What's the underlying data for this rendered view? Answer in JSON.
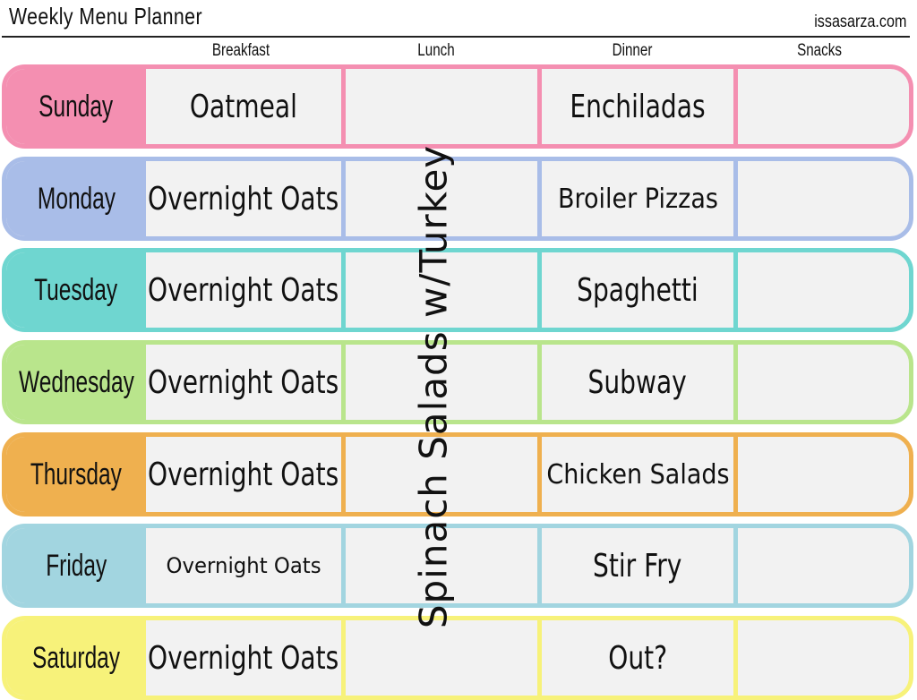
{
  "header": {
    "title": "Weekly Menu Planner",
    "website": "issasarza.com"
  },
  "columns": [
    "Breakfast",
    "Lunch",
    "Dinner",
    "Snacks"
  ],
  "lunch_all_week": "Spinach Salads w/Turkey",
  "days": [
    {
      "day": "Sunday",
      "color": "#f48fb1",
      "breakfast": "Oatmeal",
      "lunch": "",
      "dinner": "Enchiladas",
      "snacks": ""
    },
    {
      "day": "Monday",
      "color": "#a9bde8",
      "breakfast": "Overnight Oats",
      "lunch": "",
      "dinner": "Broiler Pizzas",
      "snacks": ""
    },
    {
      "day": "Tuesday",
      "color": "#6fd6d0",
      "breakfast": "Overnight Oats",
      "lunch": "",
      "dinner": "Spaghetti",
      "snacks": ""
    },
    {
      "day": "Wednesday",
      "color": "#b9e58c",
      "breakfast": "Overnight Oats",
      "lunch": "",
      "dinner": "Subway",
      "snacks": ""
    },
    {
      "day": "Thursday",
      "color": "#efb04f",
      "breakfast": "Overnight Oats",
      "lunch": "",
      "dinner": "Chicken Salads",
      "snacks": ""
    },
    {
      "day": "Friday",
      "color": "#a2d5e0",
      "breakfast": "Overnight Oats",
      "lunch": "",
      "dinner": "Stir Fry",
      "snacks": ""
    },
    {
      "day": "Saturday",
      "color": "#f7f27a",
      "breakfast": "Overnight Oats",
      "lunch": "",
      "dinner": "Out?",
      "snacks": ""
    }
  ]
}
